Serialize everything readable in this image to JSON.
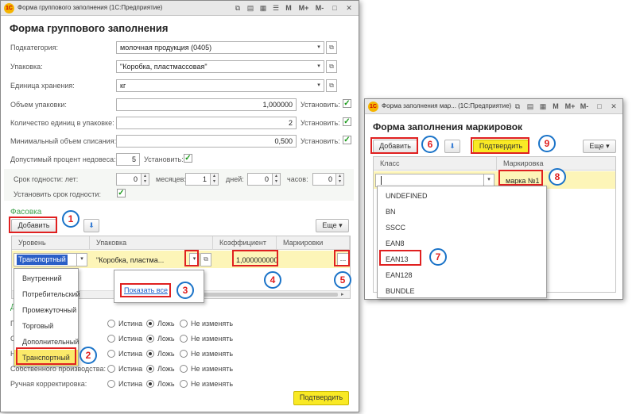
{
  "main_window": {
    "title": "Форма группового заполнения  (1С:Предприятие)",
    "heading": "Форма группового заполнения",
    "toolbar_icons": [
      "copy-icon",
      "save-icon",
      "clipboard-icon",
      "list-icon"
    ],
    "memory_buttons": [
      "M",
      "M+",
      "M-"
    ],
    "fields": {
      "subcategory": {
        "label": "Подкатегория:",
        "value": "молочная продукция (0405)"
      },
      "packaging": {
        "label": "Упаковка:",
        "value": "\"Коробка, пластмассовая\""
      },
      "unit": {
        "label": "Единица хранения:",
        "value": "кг"
      },
      "pack_volume": {
        "label": "Объем упаковки:",
        "value": "1,000000",
        "set_label": "Установить:"
      },
      "units_in_pack": {
        "label": "Количество единиц в упаковке:",
        "value": "2",
        "set_label": "Установить:"
      },
      "min_writeoff": {
        "label": "Минимальный объем списания:",
        "value": "0,500",
        "set_label": "Установить:"
      },
      "shortage_pct": {
        "label": "Допустимый процент недовеса:",
        "value": "5",
        "set_label": "Установить:"
      },
      "shelf_life": {
        "label": "Срок годности: лет:",
        "years": "0",
        "months_label": "месяцев:",
        "months": "1",
        "days_label": "дней:",
        "days": "0",
        "hours_label": "часов:",
        "hours": "0"
      },
      "set_shelf_life": {
        "label": "Установить срок годности:"
      }
    },
    "packing_section": {
      "title": "Фасовка",
      "add_button": "Добавить",
      "more_button": "Еще",
      "columns": [
        "Уровень",
        "Упаковка",
        "Коэффициент",
        "Маркировки"
      ],
      "row": {
        "level": "Транспортный",
        "packaging": "\"Коробка, пластма...",
        "coefficient": "1,000000000",
        "markings": "..."
      },
      "level_dropdown": [
        "Внутренний",
        "Потребительский",
        "Промежуточный",
        "Торговый",
        "Дополнительный",
        "Транспортный"
      ],
      "show_all_link": "Показать все"
    },
    "radio_rows": [
      {
        "label": "Пр...",
        "options": [
          "Истина",
          "Ложь",
          "Не изменять"
        ],
        "selected": 1
      },
      {
        "label": "С...",
        "options": [
          "Истина",
          "Ложь",
          "Не изменять"
        ],
        "selected": 1
      },
      {
        "label": "Н...",
        "options": [
          "Истина",
          "Ложь",
          "Не изменять"
        ],
        "selected": 1
      },
      {
        "label": "Собственного производства:",
        "options": [
          "Истина",
          "Ложь",
          "Не изменять"
        ],
        "selected": 1
      },
      {
        "label": "Ручная корректировка:",
        "options": [
          "Истина",
          "Ложь",
          "Не изменять"
        ],
        "selected": 1
      }
    ],
    "section_stub": "Д",
    "confirm_button": "Подтвердить"
  },
  "marking_window": {
    "title": "Форма заполнения мар...  (1С:Предприятие)",
    "heading": "Форма заполнения маркировок",
    "add_button": "Добавить",
    "confirm_button": "Подтвердить",
    "more_button": "Еще",
    "columns": [
      "Класс",
      "Маркировка"
    ],
    "row": {
      "class": "",
      "marking": "марка №1"
    },
    "class_dropdown": [
      "UNDEFINED",
      "BN",
      "SSCC",
      "EAN8",
      "EAN13",
      "EAN128",
      "BUNDLE"
    ]
  },
  "annotations": [
    "1",
    "2",
    "3",
    "4",
    "5",
    "6",
    "7",
    "8",
    "9"
  ],
  "colors": {
    "accent_red": "#e02020",
    "badge_blue": "#1a73c8",
    "highlight_yellow": "#f9e925",
    "row_yellow": "#fdf5b8",
    "section_green": "#3fa34d"
  }
}
